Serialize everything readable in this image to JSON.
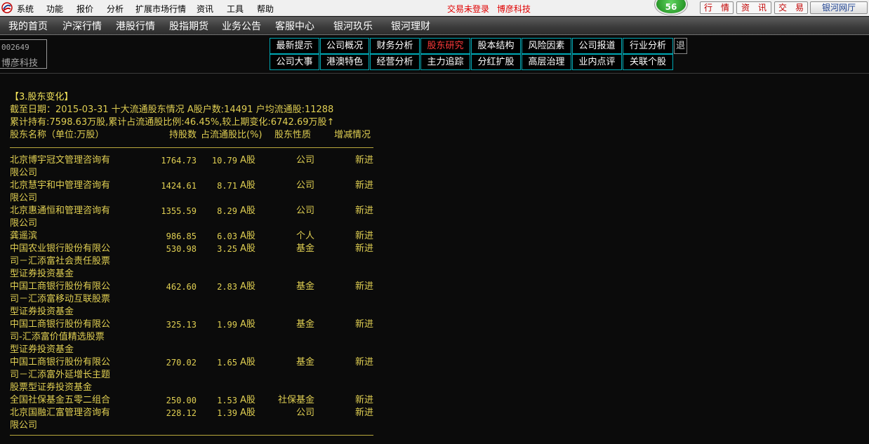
{
  "menubar": {
    "items": [
      "系统",
      "功能",
      "报价",
      "分析",
      "扩展市场行情",
      "资讯",
      "工具",
      "帮助"
    ],
    "trade_status": "交易未登录",
    "stock_name": "博彦科技",
    "badge_count": "56",
    "quick_buttons": [
      "行　情",
      "资　讯",
      "交　易"
    ],
    "galaxy_button": "银河网厅"
  },
  "navbar": {
    "items": [
      "我的首页",
      "沪深行情",
      "港股行情",
      "股指期货",
      "业务公告",
      "客服中心",
      "银河玖乐",
      "银河理财"
    ]
  },
  "stock": {
    "code": "002649",
    "name": "博彦科技"
  },
  "tabs": {
    "row1": [
      "最新提示",
      "公司概况",
      "财务分析",
      "股东研究",
      "股本结构",
      "风险因素",
      "公司报道",
      "行业分析"
    ],
    "row2": [
      "公司大事",
      "港澳特色",
      "经营分析",
      "主力追踪",
      "分红扩股",
      "高层治理",
      "业内点评",
      "关联个股"
    ],
    "active": "股东研究",
    "exit_label": "退"
  },
  "content": {
    "section_title": "【3.股东变化】",
    "summary1": "截至日期：2015-03-31 十大流通股东情况 A股户数:14491 户均流通股:11288",
    "summary2": "累计持有:7598.63万股,累计占流通股比例:46.45%,较上期变化:6742.69万股↑",
    "columns": [
      "股东名称（单位:万股）",
      "持股数",
      "占流通股比(%)",
      "股东性质",
      "增减情况"
    ],
    "rows": [
      {
        "name": [
          "北京博宇冠文管理咨询有",
          "限公司"
        ],
        "shares": "1764.73",
        "ratio": "10.79",
        "share_type": "A股",
        "nature": "公司",
        "change": "新进"
      },
      {
        "name": [
          "北京慧宇和中管理咨询有",
          "限公司"
        ],
        "shares": "1424.61",
        "ratio": "8.71",
        "share_type": "A股",
        "nature": "公司",
        "change": "新进"
      },
      {
        "name": [
          "北京惠通恒和管理咨询有",
          "限公司"
        ],
        "shares": "1355.59",
        "ratio": "8.29",
        "share_type": "A股",
        "nature": "公司",
        "change": "新进"
      },
      {
        "name": [
          "龚遥滨"
        ],
        "shares": "986.85",
        "ratio": "6.03",
        "share_type": "A股",
        "nature": "个人",
        "change": "新进"
      },
      {
        "name": [
          "中国农业银行股份有限公",
          "司－汇添富社会责任股票",
          "型证券投资基金"
        ],
        "shares": "530.98",
        "ratio": "3.25",
        "share_type": "A股",
        "nature": "基金",
        "change": "新进"
      },
      {
        "name": [
          "中国工商银行股份有限公",
          "司－汇添富移动互联股票",
          "型证券投资基金"
        ],
        "shares": "462.60",
        "ratio": "2.83",
        "share_type": "A股",
        "nature": "基金",
        "change": "新进"
      },
      {
        "name": [
          "中国工商银行股份有限公",
          "司-汇添富价值精选股票",
          "型证券投资基金"
        ],
        "shares": "325.13",
        "ratio": "1.99",
        "share_type": "A股",
        "nature": "基金",
        "change": "新进"
      },
      {
        "name": [
          "中国工商银行股份有限公",
          "司－汇添富外延增长主题",
          "股票型证券投资基金"
        ],
        "shares": "270.02",
        "ratio": "1.65",
        "share_type": "A股",
        "nature": "基金",
        "change": "新进"
      },
      {
        "name": [
          "全国社保基金五零二组合"
        ],
        "shares": "250.00",
        "ratio": "1.53",
        "share_type": "A股",
        "nature": "社保基金",
        "change": "新进"
      },
      {
        "name": [
          "北京国融汇富管理咨询有",
          "限公司"
        ],
        "shares": "228.12",
        "ratio": "1.39",
        "share_type": "A股",
        "nature": "公司",
        "change": "新进"
      }
    ]
  }
}
